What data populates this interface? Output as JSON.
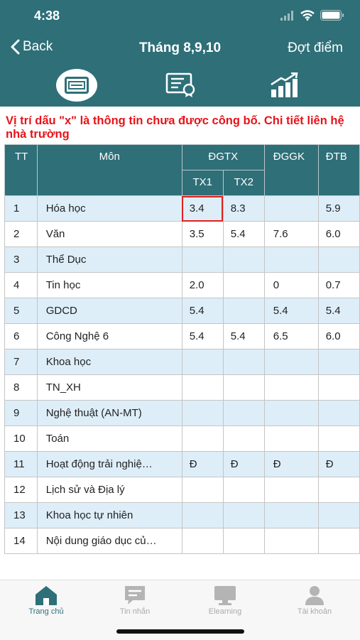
{
  "status_bar": {
    "time": "4:38"
  },
  "nav": {
    "back_label": "Back",
    "title": "Tháng 8,9,10",
    "right_label": "Đợt điểm"
  },
  "tabs": [
    {
      "icon": "certificate-card-icon",
      "active": true
    },
    {
      "icon": "award-document-icon",
      "active": false
    },
    {
      "icon": "growth-chart-icon",
      "active": false
    }
  ],
  "notice": "Vị trí dấu \"x\" là thông tin chưa được công bố. Chi tiết liên hệ nhà trường",
  "table": {
    "headers": {
      "tt": "TT",
      "subject": "Môn",
      "dgtx": "ĐGTX",
      "tx1": "TX1",
      "tx2": "TX2",
      "dggk": "ĐGGK",
      "dtb": "ĐTB"
    },
    "rows": [
      {
        "tt": "1",
        "subject": "Hóa học",
        "tx1": "3.4",
        "tx2": "8.3",
        "dggk": "",
        "dtb": "5.9"
      },
      {
        "tt": "2",
        "subject": "Văn",
        "tx1": "3.5",
        "tx2": "5.4",
        "dggk": "7.6",
        "dtb": "6.0"
      },
      {
        "tt": "3",
        "subject": "Thể Dục",
        "tx1": "",
        "tx2": "",
        "dggk": "",
        "dtb": ""
      },
      {
        "tt": "4",
        "subject": "Tin học",
        "tx1": "2.0",
        "tx2": "",
        "dggk": "0",
        "dtb": "0.7"
      },
      {
        "tt": "5",
        "subject": "GDCD",
        "tx1": "5.4",
        "tx2": "",
        "dggk": "5.4",
        "dtb": "5.4"
      },
      {
        "tt": "6",
        "subject": "Công Nghệ 6",
        "tx1": "5.4",
        "tx2": "5.4",
        "dggk": "6.5",
        "dtb": "6.0"
      },
      {
        "tt": "7",
        "subject": "Khoa học",
        "tx1": "",
        "tx2": "",
        "dggk": "",
        "dtb": ""
      },
      {
        "tt": "8",
        "subject": "TN_XH",
        "tx1": "",
        "tx2": "",
        "dggk": "",
        "dtb": ""
      },
      {
        "tt": "9",
        "subject": "Nghệ thuật (AN-MT)",
        "tx1": "",
        "tx2": "",
        "dggk": "",
        "dtb": ""
      },
      {
        "tt": "10",
        "subject": "Toán",
        "tx1": "",
        "tx2": "",
        "dggk": "",
        "dtb": ""
      },
      {
        "tt": "11",
        "subject": "Hoạt động trải nghiệ…",
        "tx1": "Đ",
        "tx2": "Đ",
        "dggk": "Đ",
        "dtb": "Đ"
      },
      {
        "tt": "12",
        "subject": "Lịch sử và Địa lý",
        "tx1": "",
        "tx2": "",
        "dggk": "",
        "dtb": ""
      },
      {
        "tt": "13",
        "subject": "Khoa học tự nhiên",
        "tx1": "",
        "tx2": "",
        "dggk": "",
        "dtb": ""
      },
      {
        "tt": "14",
        "subject": "Nội dung giáo dục củ…",
        "tx1": "",
        "tx2": "",
        "dggk": "",
        "dtb": ""
      }
    ]
  },
  "bottom_nav": [
    {
      "label": "Trang chủ",
      "icon": "home-icon",
      "active": true
    },
    {
      "label": "Tin nhắn",
      "icon": "message-icon",
      "active": false
    },
    {
      "label": "Elearning",
      "icon": "monitor-icon",
      "active": false
    },
    {
      "label": "Tài khoản",
      "icon": "user-icon",
      "active": false
    }
  ],
  "colors": {
    "primary": "#2e6f78",
    "alert": "#e8131a",
    "row_alt": "#deeef9",
    "highlight": "#e02020"
  }
}
